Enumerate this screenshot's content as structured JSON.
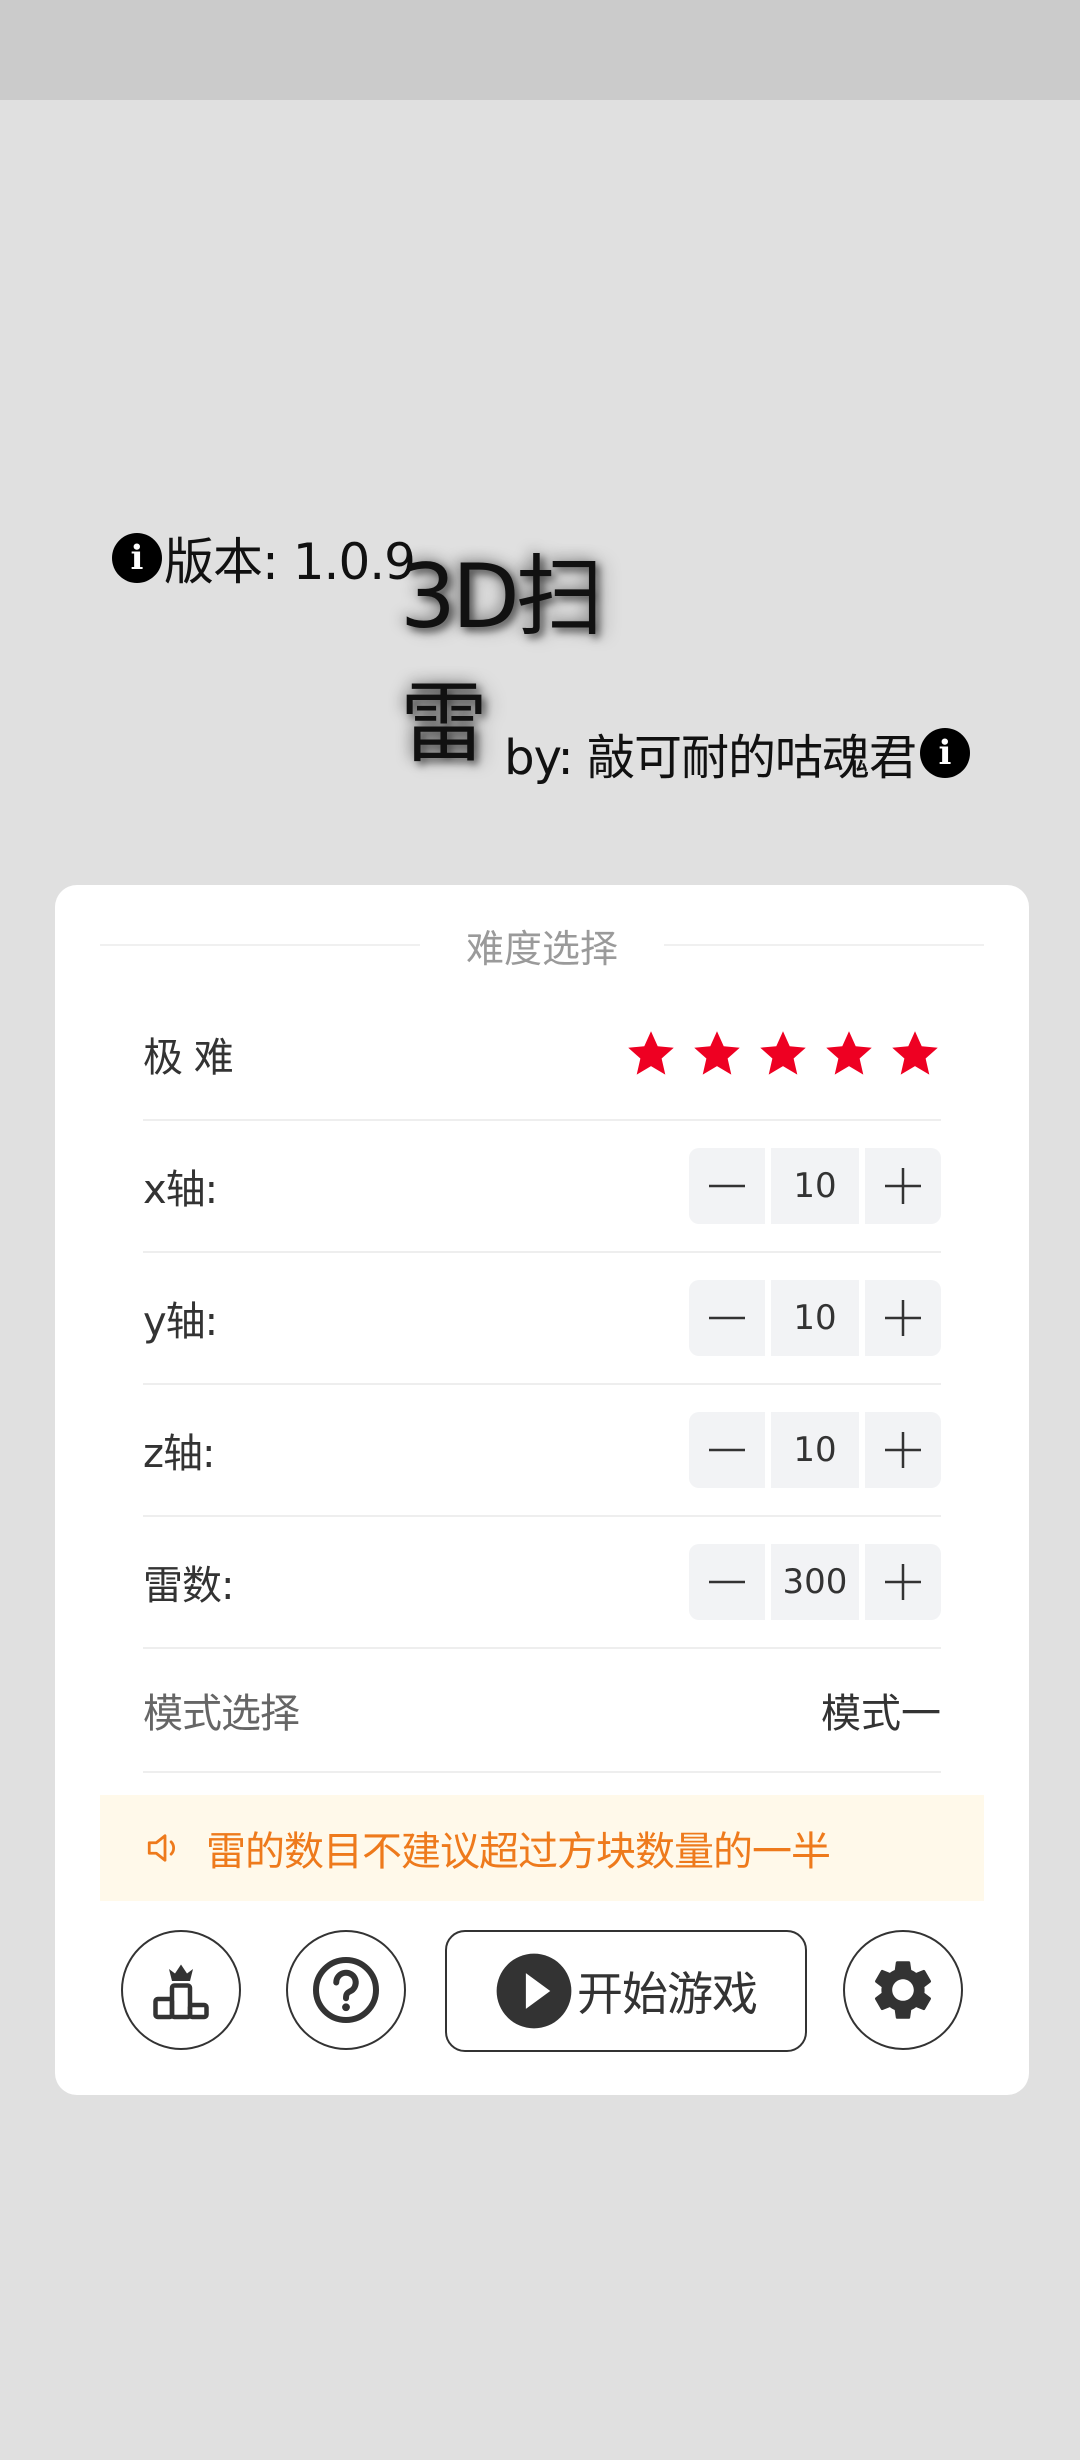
{
  "header": {
    "version_text": "版本: 1.0.9",
    "title": "3D扫雷",
    "author_text": "by: 敲可耐的咕魂君"
  },
  "difficulty": {
    "section_title": "难度选择",
    "level_label": "极 难",
    "stars": {
      "filled": 5,
      "total": 5,
      "color": "#ee0022"
    }
  },
  "settings": {
    "x_label": "x轴:",
    "x_value": "10",
    "y_label": "y轴:",
    "y_value": "10",
    "z_label": "z轴:",
    "z_value": "10",
    "mines_label": "雷数:",
    "mines_value": "300",
    "mode_label": "模式选择",
    "mode_value": "模式一"
  },
  "notice": {
    "text": "雷的数目不建议超过方块数量的一半",
    "color": "#ee7a1c",
    "icon": "speaker-icon"
  },
  "actions": {
    "start_label": "开始游戏",
    "icons": [
      "podium-icon",
      "help-icon",
      "play-icon",
      "gear-icon"
    ]
  }
}
